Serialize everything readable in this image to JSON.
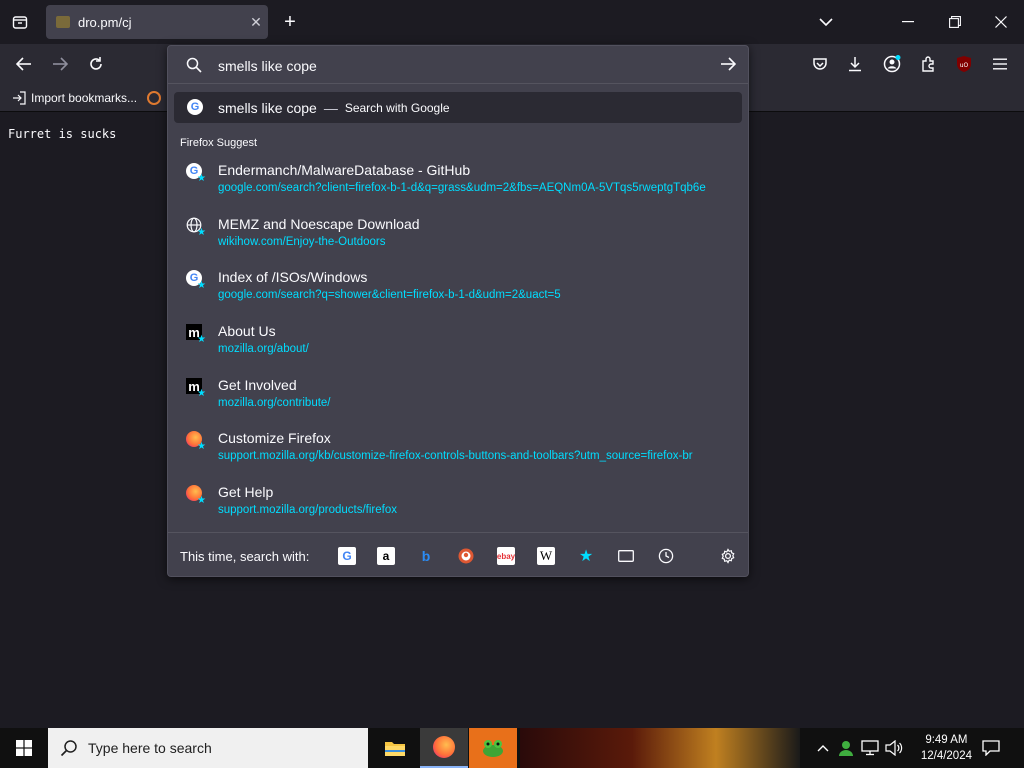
{
  "tab": {
    "title": "dro.pm/cj"
  },
  "bookmarks": {
    "import_label": "Import bookmarks..."
  },
  "page": {
    "body_text": "Furret is sucks"
  },
  "urlbar": {
    "value": "smells like cope"
  },
  "search_row": {
    "query": "smells like cope",
    "separator": "—",
    "action": "Search with Google"
  },
  "section_label": "Firefox Suggest",
  "suggestions": [
    {
      "icon": "google-icon",
      "title": "Endermanch/MalwareDatabase - GitHub",
      "url": "google.com/search?client=firefox-b-1-d&q=grass&udm=2&fbs=AEQNm0A-5VTqs5rweptgTqb6e"
    },
    {
      "icon": "globe-icon",
      "title": "MEMZ and Noescape Download",
      "url": "wikihow.com/Enjoy-the-Outdoors"
    },
    {
      "icon": "google-icon",
      "title": "Index of /ISOs/Windows",
      "url": "google.com/search?q=shower&client=firefox-b-1-d&udm=2&uact=5"
    },
    {
      "icon": "mozilla-icon",
      "title": "About Us",
      "url": "mozilla.org/about/"
    },
    {
      "icon": "mozilla-icon",
      "title": "Get Involved",
      "url": "mozilla.org/contribute/"
    },
    {
      "icon": "firefox-icon",
      "title": "Customize Firefox",
      "url": "support.mozilla.org/kb/customize-firefox-controls-buttons-and-toolbars?utm_source=firefox-br"
    },
    {
      "icon": "firefox-icon",
      "title": "Get Help",
      "url": "support.mozilla.org/products/firefox"
    }
  ],
  "footer": {
    "label": "This time, search with:"
  },
  "taskbar": {
    "search_placeholder": "Type here to search",
    "time": "9:49 AM",
    "date": "12/4/2024"
  },
  "colors": {
    "accent": "#00ddff",
    "panel": "#42414d",
    "toolbar": "#2b2a33",
    "bg": "#1c1b22"
  }
}
